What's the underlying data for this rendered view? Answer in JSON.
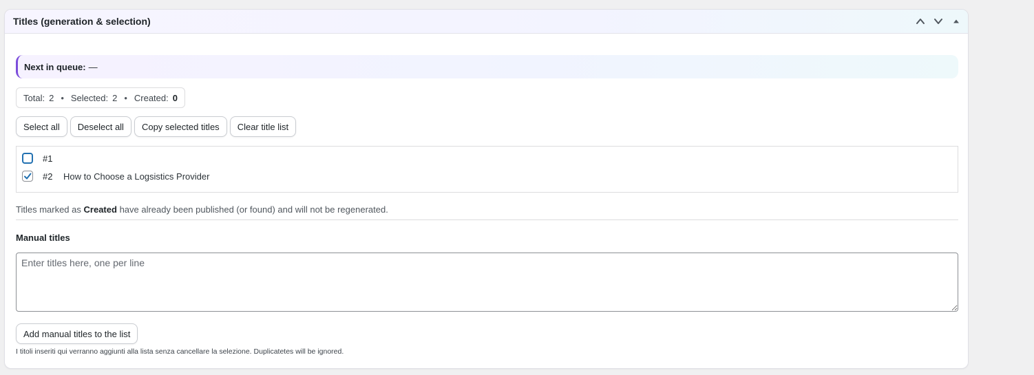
{
  "panel": {
    "title": "Titles (generation & selection)",
    "controls": [
      {
        "name": "move-up-icon",
        "glyph": "chevron-up"
      },
      {
        "name": "move-down-icon",
        "glyph": "chevron-down"
      },
      {
        "name": "toggle-panel-icon",
        "glyph": "triangle-up"
      }
    ]
  },
  "queue": {
    "label": "Next in queue:",
    "value": "—"
  },
  "stats": {
    "total_label": "Total:",
    "total_value": "2",
    "selected_label": "Selected:",
    "selected_value": "2",
    "created_label": "Created:",
    "created_value": "0",
    "separator": "•"
  },
  "actions": {
    "select_all": "Select all",
    "deselect_all": "Deselect all",
    "copy_selected": "Copy selected titles",
    "clear_list": "Clear title list"
  },
  "titles": [
    {
      "num": "#1",
      "text": "",
      "checked": false
    },
    {
      "num": "#2",
      "text": "How to Choose a Logsistics Provider",
      "checked": true
    }
  ],
  "help": {
    "prefix": "Titles marked as",
    "bold": "Created",
    "suffix": "have already been published (or found) and will not be regenerated."
  },
  "manual": {
    "label": "Manual titles",
    "placeholder": "Enter titles here, one per line",
    "value": "",
    "add_button": "Add manual titles to the list",
    "note": "I titoli inseriti qui verranno aggiunti alla lista senza cancellare la selezione. Duplicatetes will be ignored."
  },
  "colors": {
    "accent": "#7b4cdb",
    "checkbox_border": "#2271b1",
    "checkmark": "#2271b1"
  }
}
